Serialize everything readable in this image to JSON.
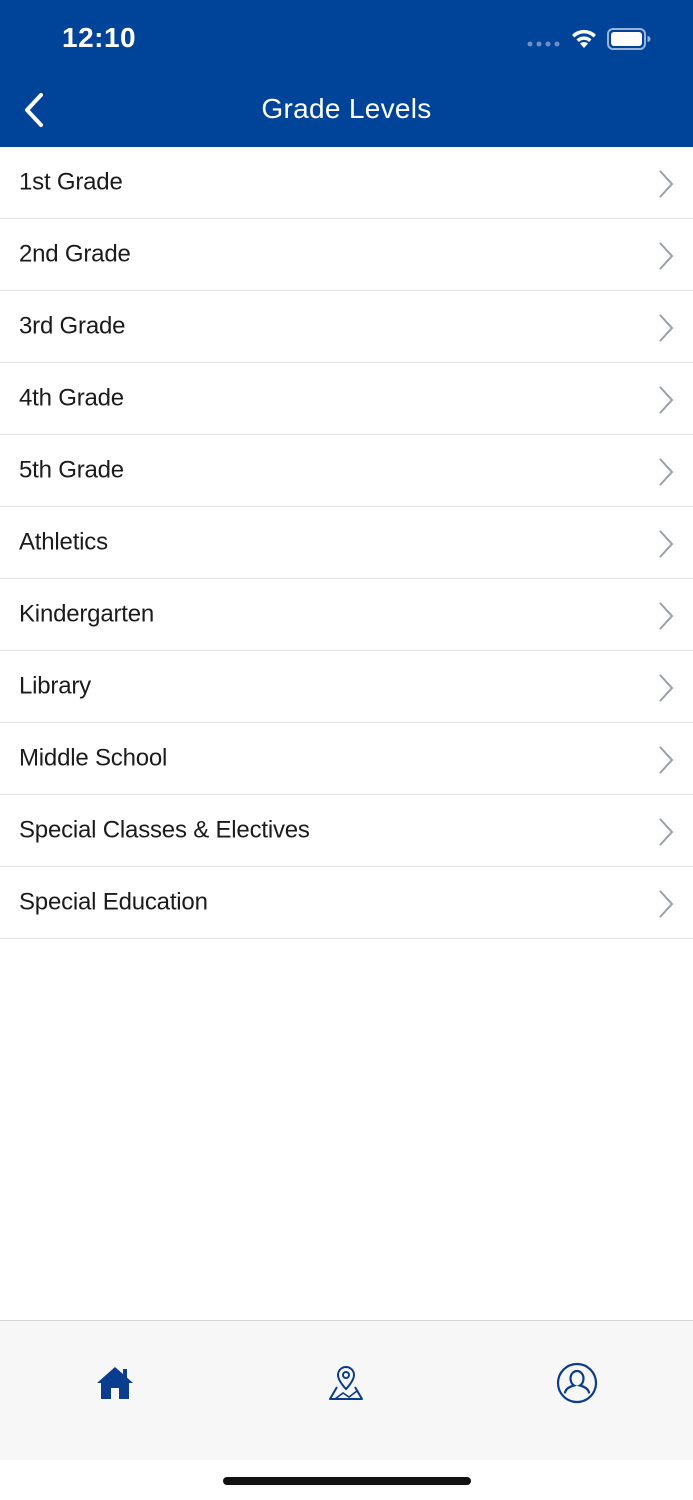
{
  "status_bar": {
    "time": "12:10",
    "icons": [
      "signal-dots-icon",
      "wifi-icon",
      "battery-icon"
    ]
  },
  "nav": {
    "title": "Grade Levels",
    "back_icon": "chevron-left-icon"
  },
  "grade_levels": [
    {
      "label": "1st Grade"
    },
    {
      "label": "2nd Grade"
    },
    {
      "label": "3rd Grade"
    },
    {
      "label": "4th Grade"
    },
    {
      "label": "5th Grade"
    },
    {
      "label": "Athletics"
    },
    {
      "label": "Kindergarten"
    },
    {
      "label": "Library"
    },
    {
      "label": "Middle School"
    },
    {
      "label": "Special Classes & Electives"
    },
    {
      "label": "Special Education"
    }
  ],
  "tabbar": {
    "tabs": [
      {
        "icon": "home-icon",
        "active": true
      },
      {
        "icon": "map-pin-icon",
        "active": false
      },
      {
        "icon": "user-profile-icon",
        "active": false
      }
    ]
  },
  "colors": {
    "header_bg": "#00449a",
    "accent": "#0a3d8f",
    "chevron": "#9aa0a8",
    "text": "#1b1b1b"
  }
}
